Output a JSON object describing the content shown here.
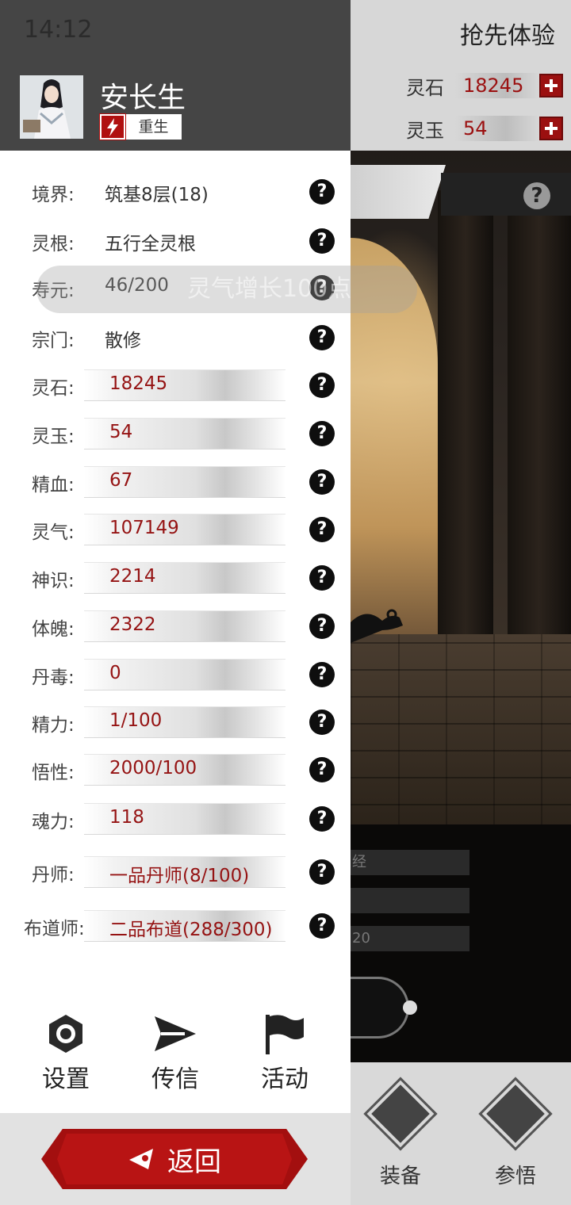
{
  "status_bar": {
    "time": "14:12"
  },
  "header": {
    "player_name": "安长生",
    "tag_label": "重生",
    "early_access": "抢先体验",
    "resources": [
      {
        "label": "灵石",
        "value": "18245"
      },
      {
        "label": "灵玉",
        "value": "54"
      }
    ]
  },
  "floating_tip": "灵气增长100点",
  "stats": [
    {
      "label": "境界:",
      "value": "筑基8层(18)",
      "style": "plain"
    },
    {
      "label": "灵根:",
      "value": "五行全灵根",
      "style": "plain"
    },
    {
      "label": "寿元:",
      "value": "46/200",
      "style": "plain"
    },
    {
      "label": "宗门:",
      "value": "散修",
      "style": "plain"
    },
    {
      "label": "灵石:",
      "value": "18245",
      "style": "bar"
    },
    {
      "label": "灵玉:",
      "value": "54",
      "style": "bar"
    },
    {
      "label": "精血:",
      "value": "67",
      "style": "bar"
    },
    {
      "label": "灵气:",
      "value": "107149",
      "style": "bar"
    },
    {
      "label": "神识:",
      "value": "2214",
      "style": "bar"
    },
    {
      "label": "体魄:",
      "value": "2322",
      "style": "bar"
    },
    {
      "label": "丹毒:",
      "value": "0",
      "style": "bar"
    },
    {
      "label": "精力:",
      "value": "1/100",
      "style": "bar"
    },
    {
      "label": "悟性:",
      "value": "2000/100",
      "style": "bar"
    },
    {
      "label": "魂力:",
      "value": "118",
      "style": "bar"
    },
    {
      "label": "丹师:",
      "value": "一品丹师(8/100)",
      "style": "bar"
    },
    {
      "label": "布道师:",
      "value": "二品布道(288/300)",
      "style": "bar"
    }
  ],
  "help_glyph": "?",
  "menu": [
    {
      "label": "设置",
      "icon": "gear-icon"
    },
    {
      "label": "传信",
      "icon": "send-icon"
    },
    {
      "label": "活动",
      "icon": "flag-icon"
    }
  ],
  "back_button": {
    "label": "返回",
    "icon": "back-arrow-icon"
  },
  "background": {
    "rows": [
      "经",
      "",
      "20"
    ],
    "nav": [
      {
        "label": "装备",
        "icon": "sword-icon"
      },
      {
        "label": "参悟",
        "icon": "book-icon"
      }
    ]
  },
  "colors": {
    "accent_red": "#a30f0f",
    "header_dark": "#454545",
    "value_red": "#951313"
  }
}
